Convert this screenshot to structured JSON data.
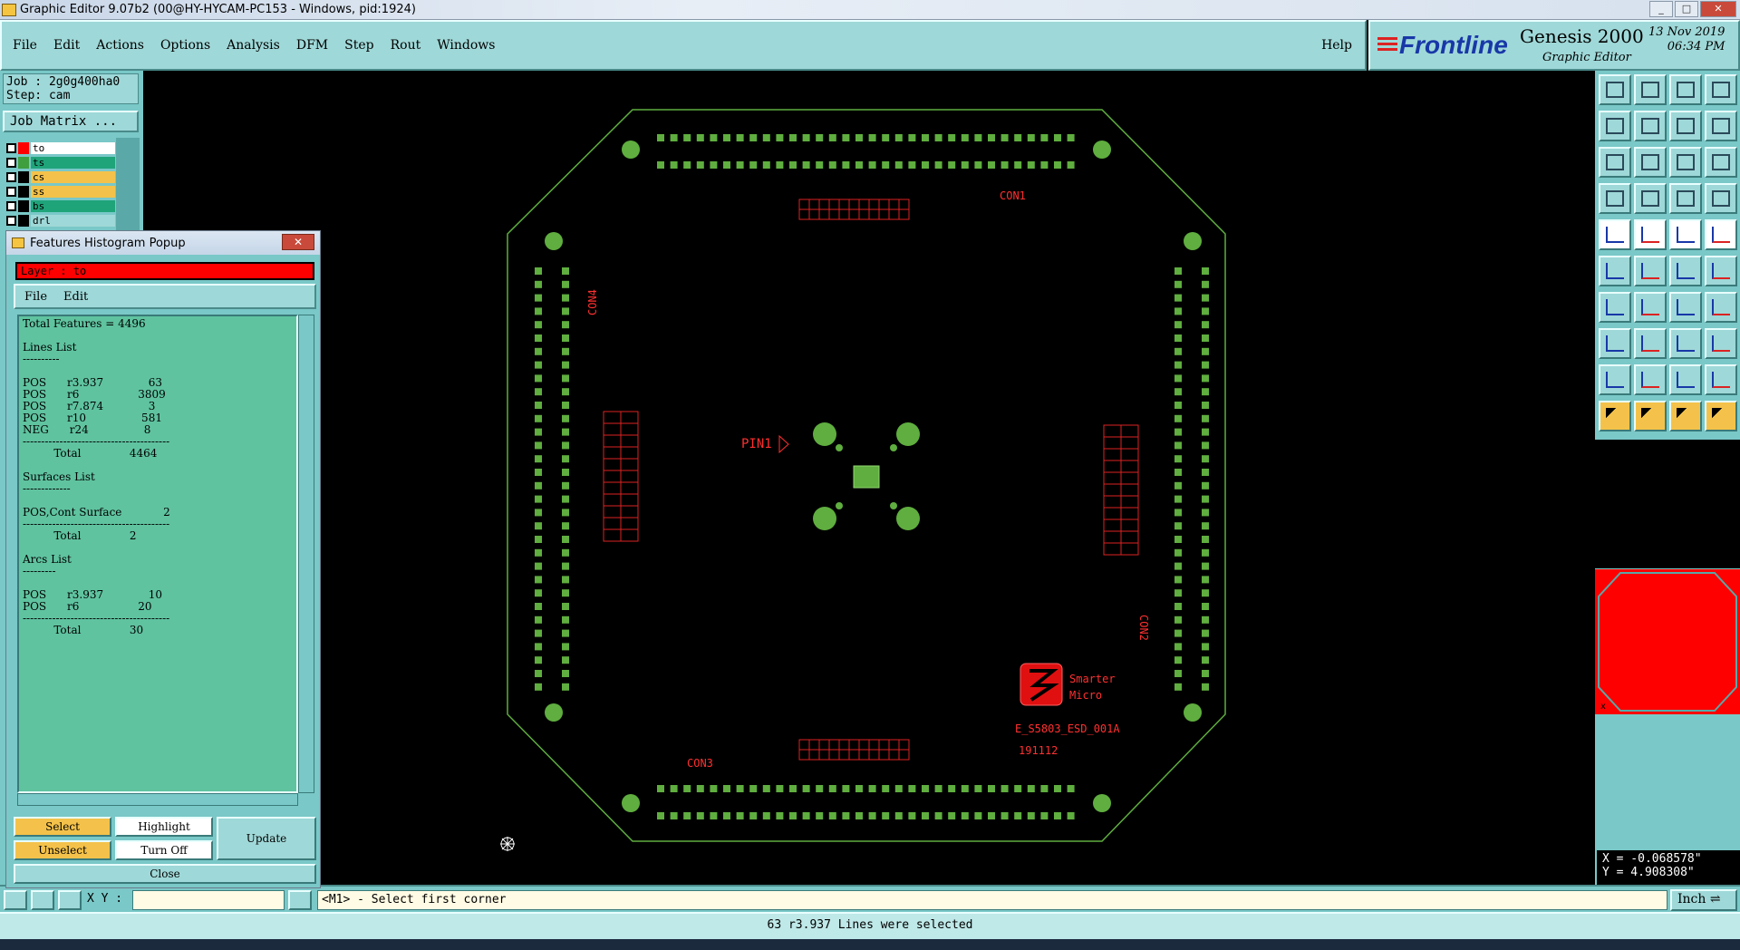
{
  "window": {
    "title": "Graphic Editor 9.07b2 (00@HY-HYCAM-PC153 - Windows, pid:1924)",
    "controls": [
      "_",
      "□",
      "✕"
    ]
  },
  "menu": {
    "items": [
      "File",
      "Edit",
      "Actions",
      "Options",
      "Analysis",
      "DFM",
      "Step",
      "Rout",
      "Windows"
    ],
    "help": "Help"
  },
  "brand": {
    "logo": "Frontline",
    "product": "Genesis 2000",
    "subtitle": "Graphic Editor",
    "date": "13 Nov 2019",
    "time": "06:34 PM"
  },
  "job": {
    "job": "Job : 2g0g400ha0",
    "step": "Step: cam",
    "matrix_button": "Job Matrix ..."
  },
  "layers": [
    {
      "name": "to",
      "color": "#ffffff",
      "swatch": "#ff0000"
    },
    {
      "name": "ts",
      "color": "#1fa47a",
      "swatch": "#3f9f3f"
    },
    {
      "name": "cs",
      "color": "#f4c24a",
      "swatch": "#000000"
    },
    {
      "name": "ss",
      "color": "#f4c24a",
      "swatch": "#000000"
    },
    {
      "name": "bs",
      "color": "#1fa47a",
      "swatch": "#000000"
    },
    {
      "name": "drl",
      "color": "#9fd8d8",
      "swatch": "#000000"
    }
  ],
  "popup": {
    "title": "Features Histogram Popup",
    "layer_label": "Layer :  to",
    "menu": [
      "File",
      "Edit"
    ],
    "report": "Total Features = 4496\n\nLines List\n----------\n\nPOS      r3.937             63\nPOS      r6                 3809\nPOS      r7.874             3\nPOS      r10                581\nNEG      r24                8\n----------------------------------------\n         Total              4464\n\nSurfaces List\n-------------\n\nPOS,Cont Surface            2\n----------------------------------------\n         Total              2\n\nArcs List\n---------\n\nPOS      r3.937             10\nPOS      r6                 20\n----------------------------------------\n         Total              30",
    "buttons": {
      "select": "Select",
      "highlight": "Highlight",
      "update": "Update",
      "unselect": "Unselect",
      "turn_off": "Turn Off",
      "close": "Close"
    }
  },
  "board": {
    "labels": {
      "con1": "CON1",
      "con2": "CON2",
      "con3": "CON3",
      "con4": "CON4",
      "pin1": "PIN1",
      "logo1": "Smarter",
      "logo2": "Micro",
      "part": "E_S5803_ESD_001A",
      "date": "191112"
    }
  },
  "coords": {
    "x": "X = -0.068578\"",
    "y": "Y =  4.908308\""
  },
  "command": {
    "xy_label": "X Y :",
    "xy_value": "",
    "prompt": "<M1> - Select first corner",
    "unit": "Inch"
  },
  "status": "63 r3.937 Lines were selected"
}
